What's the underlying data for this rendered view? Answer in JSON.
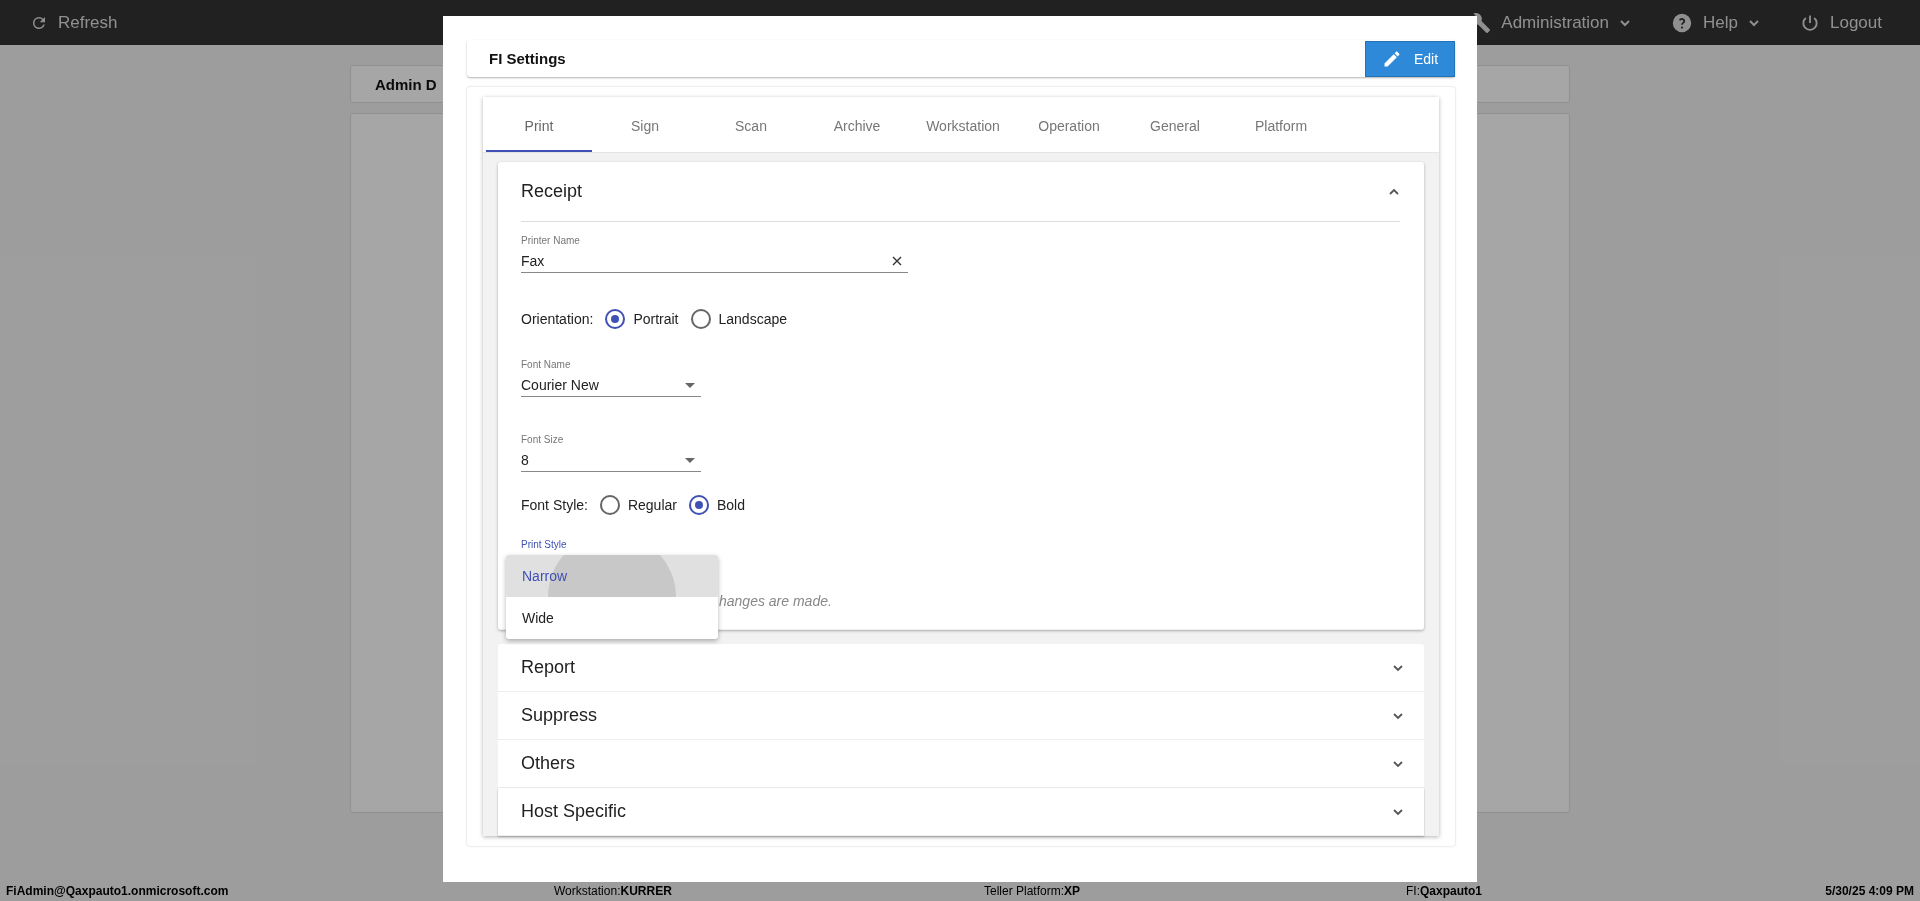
{
  "topbar": {
    "refresh": "Refresh",
    "menus": [
      {
        "label": "Administration"
      },
      {
        "label": "Help"
      }
    ],
    "logout": "Logout"
  },
  "background": {
    "card_title": "Admin D"
  },
  "dialog": {
    "title": "FI Settings",
    "edit_button": "Edit",
    "tabs": [
      {
        "label": "Print",
        "selected": true
      },
      {
        "label": "Sign",
        "selected": false
      },
      {
        "label": "Scan",
        "selected": false
      },
      {
        "label": "Archive",
        "selected": false
      },
      {
        "label": "Workstation",
        "selected": false
      },
      {
        "label": "Operation",
        "selected": false
      },
      {
        "label": "General",
        "selected": false
      },
      {
        "label": "Platform",
        "selected": false
      }
    ],
    "sections": [
      {
        "title": "Receipt",
        "expanded": true
      },
      {
        "title": "Report",
        "expanded": false
      },
      {
        "title": "Suppress",
        "expanded": false
      },
      {
        "title": "Others",
        "expanded": false
      },
      {
        "title": "Host Specific",
        "expanded": false
      }
    ],
    "receipt": {
      "printer_name": {
        "label": "Printer Name",
        "value": "Fax"
      },
      "orientation": {
        "label": "Orientation:",
        "options": [
          {
            "label": "Portrait",
            "selected": true
          },
          {
            "label": "Landscape",
            "selected": false
          }
        ]
      },
      "font_name": {
        "label": "Font Name",
        "value": "Courier New"
      },
      "font_size": {
        "label": "Font Size",
        "value": "8"
      },
      "font_style": {
        "label": "Font Style:",
        "options": [
          {
            "label": "Regular",
            "selected": false
          },
          {
            "label": "Bold",
            "selected": true
          }
        ]
      },
      "print_style": {
        "label": "Print Style",
        "options": [
          {
            "label": "Narrow",
            "selected": true
          },
          {
            "label": "Wide",
            "selected": false
          }
        ]
      },
      "note": "hanges are made."
    }
  },
  "status_bar": [
    {
      "value": "FiAdmin@Qaxpauto1.onmicrosoft.com"
    },
    {
      "label": "Workstation:",
      "value": "KURRER"
    },
    {
      "label": "Teller Platform:",
      "value": "XP"
    },
    {
      "label": "FI:",
      "value": "Qaxpauto1"
    },
    {
      "value": "5/30/25 4:09 PM"
    }
  ]
}
